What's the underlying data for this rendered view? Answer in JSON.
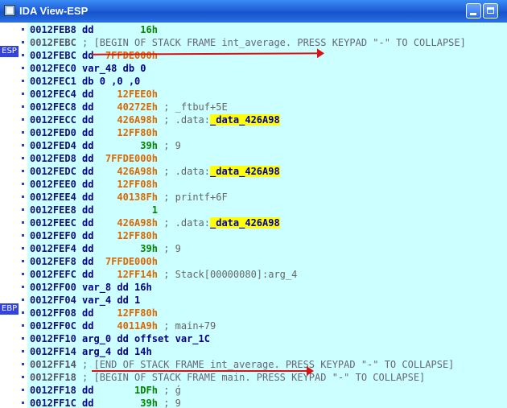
{
  "window": {
    "title": "IDA View-ESP"
  },
  "registers": {
    "esp": "ESP",
    "ebp": "EBP"
  },
  "lines": [
    {
      "addr": "0012FEB8",
      "a": "dd",
      "b": "        16h",
      "c": "",
      "d": "",
      "e": ""
    },
    {
      "addr": "0012FEBC",
      "a": "; [BEGIN OF STACK FRAME int_average. PRESS KEYPAD \"-\" TO COLLAPSE]",
      "b": "",
      "c": "",
      "d": "",
      "e": ""
    },
    {
      "addr": "0012FEBC",
      "a": "dd",
      "b": "  7FFDE000h",
      "c": "",
      "d": "",
      "e": ""
    },
    {
      "addr": "0012FEC0",
      "a": "var_48 db 0",
      "b": "",
      "c": "",
      "d": "",
      "e": ""
    },
    {
      "addr": "0012FEC1",
      "a": "db 0 ,0 ,0",
      "b": "",
      "c": "",
      "d": "",
      "e": ""
    },
    {
      "addr": "0012FEC4",
      "a": "dd",
      "b": "    12FEE0h",
      "c": "",
      "d": "",
      "e": ""
    },
    {
      "addr": "0012FEC8",
      "a": "dd",
      "b": "    40272Eh",
      "c": " ; _ftbuf+5E",
      "d": "",
      "e": ""
    },
    {
      "addr": "0012FECC",
      "a": "dd",
      "b": "    426A98h",
      "c": " ; .data:",
      "d": "_data_426A98",
      "e": ""
    },
    {
      "addr": "0012FED0",
      "a": "dd",
      "b": "    12FF80h",
      "c": "",
      "d": "",
      "e": ""
    },
    {
      "addr": "0012FED4",
      "a": "dd",
      "b": "        39h",
      "c": " ; 9",
      "d": "",
      "e": ""
    },
    {
      "addr": "0012FED8",
      "a": "dd",
      "b": "  7FFDE000h",
      "c": "",
      "d": "",
      "e": ""
    },
    {
      "addr": "0012FEDC",
      "a": "dd",
      "b": "    426A98h",
      "c": " ; .data:",
      "d": "_data_426A98",
      "e": ""
    },
    {
      "addr": "0012FEE0",
      "a": "dd",
      "b": "    12FF08h",
      "c": "",
      "d": "",
      "e": ""
    },
    {
      "addr": "0012FEE4",
      "a": "dd",
      "b": "    40138Fh",
      "c": " ; printf+6F",
      "d": "",
      "e": ""
    },
    {
      "addr": "0012FEE8",
      "a": "dd",
      "b": "          1",
      "c": "",
      "d": "",
      "e": ""
    },
    {
      "addr": "0012FEEC",
      "a": "dd",
      "b": "    426A98h",
      "c": " ; .data:",
      "d": "_data_426A98",
      "e": ""
    },
    {
      "addr": "0012FEF0",
      "a": "dd",
      "b": "    12FF80h",
      "c": "",
      "d": "",
      "e": ""
    },
    {
      "addr": "0012FEF4",
      "a": "dd",
      "b": "        39h",
      "c": " ; 9",
      "d": "",
      "e": ""
    },
    {
      "addr": "0012FEF8",
      "a": "dd",
      "b": "  7FFDE000h",
      "c": "",
      "d": "",
      "e": ""
    },
    {
      "addr": "0012FEFC",
      "a": "dd",
      "b": "    12FF14h",
      "c": " ; Stack[00000080]:arg_4",
      "d": "",
      "e": ""
    },
    {
      "addr": "0012FF00",
      "a": "var_8 dd 16h",
      "b": "",
      "c": "",
      "d": "",
      "e": ""
    },
    {
      "addr": "0012FF04",
      "a": "var_4 dd 1",
      "b": "",
      "c": "",
      "d": "",
      "e": ""
    },
    {
      "addr": "0012FF08",
      "a": "dd",
      "b": "    12FF80h",
      "c": "",
      "d": "",
      "e": ""
    },
    {
      "addr": "0012FF0C",
      "a": "dd",
      "b": "    4011A9h",
      "c": " ; main+79",
      "d": "",
      "e": ""
    },
    {
      "addr": "0012FF10",
      "a": "arg_0 dd offset var_1C",
      "b": "",
      "c": "",
      "d": "",
      "e": ""
    },
    {
      "addr": "0012FF14",
      "a": "arg_4 dd 14h",
      "b": "",
      "c": "",
      "d": "",
      "e": ""
    },
    {
      "addr": "0012FF14",
      "a": "; [END OF STACK FRAME int_average. PRESS KEYPAD \"-\" TO COLLAPSE]",
      "b": "",
      "c": "",
      "d": "",
      "e": ""
    },
    {
      "addr": "0012FF18",
      "a": "; [BEGIN OF STACK FRAME main. PRESS KEYPAD \"-\" TO COLLAPSE]",
      "b": "",
      "c": "",
      "d": "",
      "e": ""
    },
    {
      "addr": "0012FF18",
      "a": "dd",
      "b": "       1DFh",
      "c": " ; ǵ",
      "d": "",
      "e": ""
    },
    {
      "addr": "0012FF1C",
      "a": "dd",
      "b": "        39h",
      "c": " ; 9",
      "d": "",
      "e": ""
    }
  ],
  "colors": {
    "background": "#ccffff",
    "highlight": "#ffff00",
    "arrow": "#dd1111",
    "register_badge": "#3344dd"
  }
}
